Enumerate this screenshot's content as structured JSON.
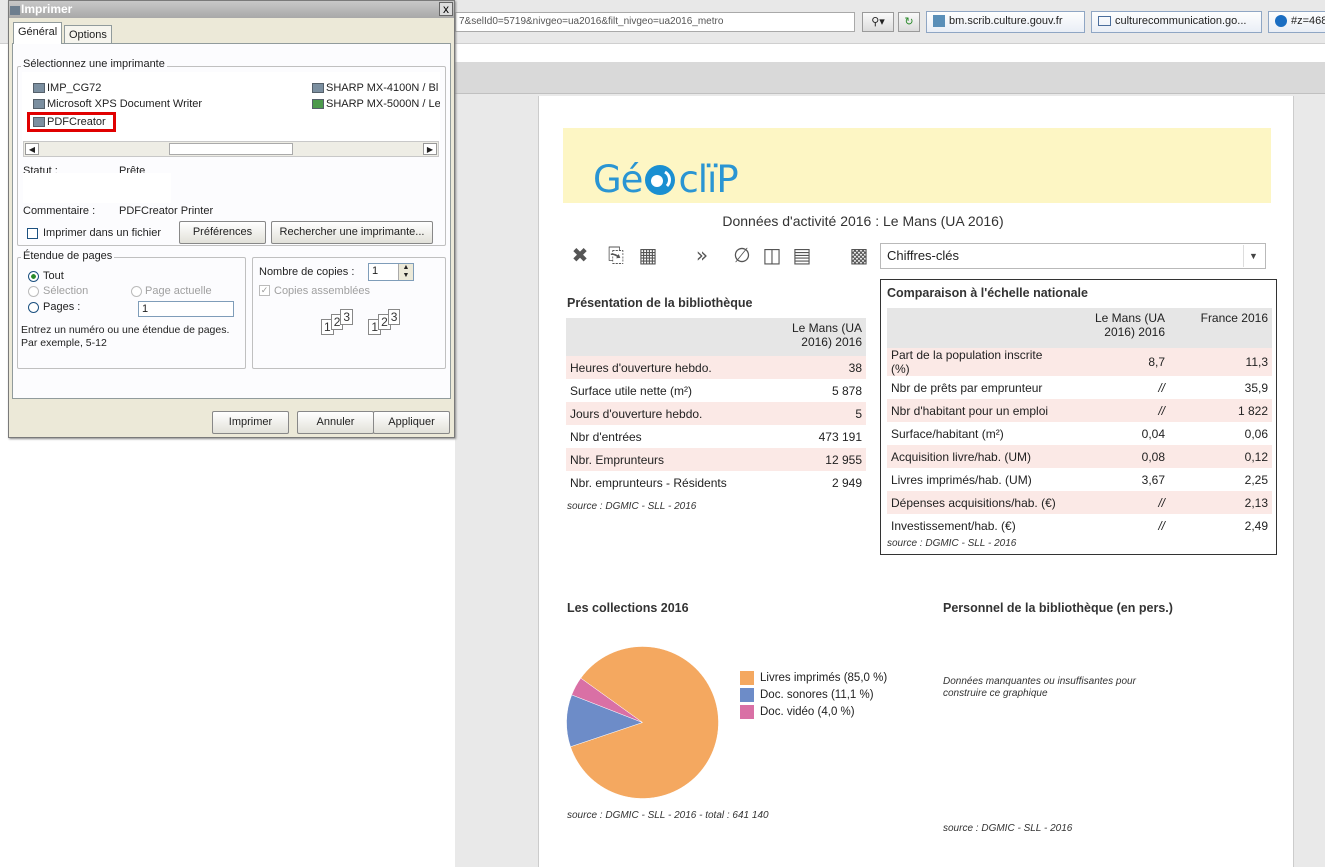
{
  "browser": {
    "url": "7&selId0=5719&nivgeo=ua2016&filt_nivgeo=ua2016_metro",
    "tabs": [
      "bm.scrib.culture.gouv.fr",
      "culturecommunication.go...",
      "#z=468"
    ]
  },
  "page": {
    "logo": "GéoClip",
    "title": "Données d'activité 2016 : Le Mans (UA 2016)",
    "select_value": "Chiffres-clés",
    "toolbar_icons": [
      "close-icon",
      "print-icon",
      "print-all-icon",
      "forward-icon",
      "empty-set-icon",
      "table-icon",
      "save-icon",
      "trash-icon"
    ]
  },
  "presentation": {
    "title": "Présentation de la bibliothèque",
    "header": "Le Mans (UA 2016) 2016",
    "rows": [
      {
        "label": "Heures d'ouverture hebdo.",
        "value": "38"
      },
      {
        "label": "Surface utile nette (m²)",
        "value": "5 878"
      },
      {
        "label": "Jours d'ouverture hebdo.",
        "value": "5"
      },
      {
        "label": "Nbr d'entrées",
        "value": "473 191"
      },
      {
        "label": "Nbr. Emprunteurs",
        "value": "12 955"
      },
      {
        "label": "Nbr. emprunteurs - Résidents",
        "value": "2 949"
      }
    ],
    "source": "source : DGMIC - SLL - 2016"
  },
  "comparison": {
    "title": "Comparaison à l'échelle nationale",
    "headers": [
      "Le Mans (UA 2016) 2016",
      "France 2016"
    ],
    "rows": [
      {
        "label": "Part de la population inscrite (%)",
        "a": "8,7",
        "b": "11,3"
      },
      {
        "label": "Nbr de prêts par emprunteur",
        "a": "//",
        "b": "35,9"
      },
      {
        "label": "Nbr d'habitant pour un emploi",
        "a": "//",
        "b": "1 822"
      },
      {
        "label": "Surface/habitant (m²)",
        "a": "0,04",
        "b": "0,06"
      },
      {
        "label": "Acquisition livre/hab. (UM)",
        "a": "0,08",
        "b": "0,12"
      },
      {
        "label": "Livres imprimés/hab. (UM)",
        "a": "3,67",
        "b": "2,25"
      },
      {
        "label": "Dépenses acquisitions/hab. (€)",
        "a": "//",
        "b": "2,13"
      },
      {
        "label": "Investissement/hab. (€)",
        "a": "//",
        "b": "2,49"
      }
    ],
    "source": "source : DGMIC - SLL - 2016"
  },
  "collections": {
    "title": "Les collections 2016",
    "source": "source : DGMIC - SLL - 2016 - total : 641 140"
  },
  "chart_data": {
    "type": "pie",
    "categories": [
      "Livres imprimés (85,0 %)",
      "Doc. sonores (11,1 %)",
      "Doc. vidéo (4,0 %)"
    ],
    "values": [
      85.0,
      11.1,
      4.0
    ],
    "colors": [
      "#f4a860",
      "#6d8cc8",
      "#d970a5"
    ],
    "legend": "right"
  },
  "personnel": {
    "title": "Personnel de la bibliothèque (en pers.)",
    "missing": "Données manquantes ou insuffisantes pour construire ce graphique",
    "source": "source : DGMIC - SLL - 2016"
  },
  "dialog": {
    "title": "Imprimer",
    "close": "x",
    "tabs": [
      "Général",
      "Options"
    ],
    "select_printer_label": "Sélectionnez une imprimante",
    "printers_left": [
      "IMP_CG72",
      "Microsoft XPS Document Writer",
      "PDFCreator"
    ],
    "printers_right": [
      "SHARP MX-4100N / Bl",
      "SHARP MX-5000N / Le"
    ],
    "status_label": "Statut :",
    "status_value": "Prête",
    "comment_label": "Commentaire :",
    "comment_value": "PDFCreator Printer",
    "print_to_file": "Imprimer dans un fichier",
    "preferences": "Préférences",
    "find_printer": "Rechercher une imprimante...",
    "page_range_label": "Étendue de pages",
    "all": "Tout",
    "selection": "Sélection",
    "current_page": "Page actuelle",
    "pages": "Pages :",
    "pages_value": "1",
    "hint": "Entrez un numéro ou une étendue de pages. Par exemple, 5-12",
    "copies_label": "Nombre de copies :",
    "copies_value": "1",
    "collate": "Copies assemblées",
    "print": "Imprimer",
    "cancel": "Annuler",
    "apply": "Appliquer"
  }
}
